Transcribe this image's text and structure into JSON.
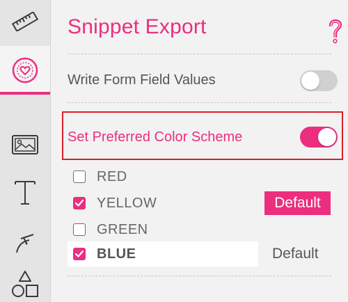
{
  "colors": {
    "accent": "#ec2e7f",
    "highlight_border": "#d81f26",
    "toggle_off": "#d0d0d0"
  },
  "sidebar": {
    "items": [
      {
        "icon": "ruler-icon"
      },
      {
        "icon": "heart-badge-icon",
        "active": true
      },
      {
        "icon": "image-icon"
      },
      {
        "icon": "text-icon"
      },
      {
        "icon": "draw-path-icon"
      },
      {
        "icon": "shapes-icon"
      }
    ]
  },
  "header": {
    "title": "Snippet Export",
    "help_icon": "question-mark-icon"
  },
  "settings": {
    "write_form_field_values": {
      "label": "Write Form Field Values",
      "enabled": false
    },
    "set_preferred_color_scheme": {
      "label": "Set Preferred Color Scheme",
      "enabled": true
    }
  },
  "color_schemes": {
    "options": [
      {
        "label": "RED",
        "checked": false
      },
      {
        "label": "YELLOW",
        "checked": true,
        "default_label": "Default",
        "default_style": "button"
      },
      {
        "label": "GREEN",
        "checked": false
      },
      {
        "label": "BLUE",
        "checked": true,
        "default_label": "Default",
        "default_style": "text",
        "selected_row": true
      }
    ]
  }
}
